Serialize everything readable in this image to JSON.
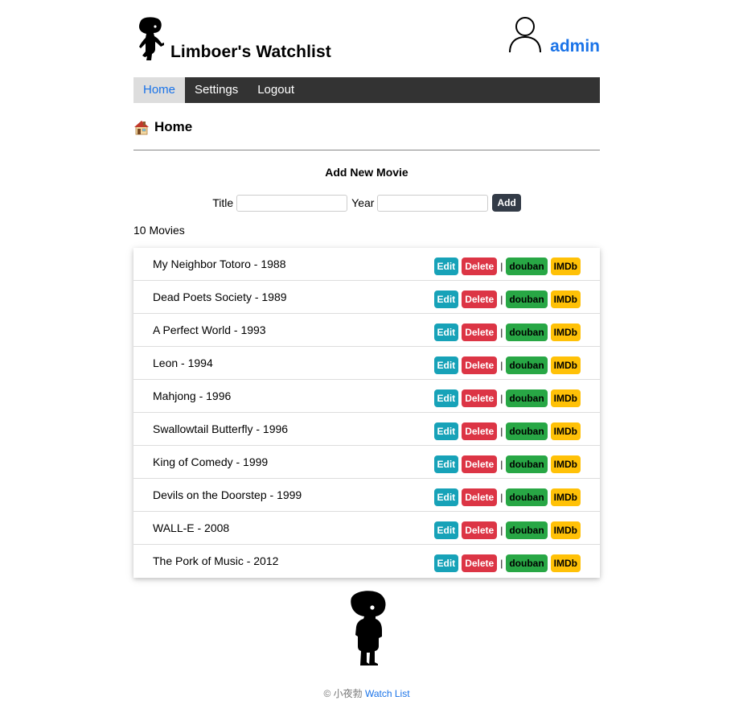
{
  "header": {
    "site_title": "Limboer's Watchlist",
    "username": "admin"
  },
  "nav": {
    "items": [
      {
        "label": "Home",
        "active": true
      },
      {
        "label": "Settings",
        "active": false
      },
      {
        "label": "Logout",
        "active": false
      }
    ]
  },
  "page": {
    "heading": "Home",
    "heading_icon": "house-icon"
  },
  "form": {
    "title": "Add New Movie",
    "title_label": "Title",
    "title_value": "",
    "year_label": "Year",
    "year_value": "",
    "submit_label": "Add"
  },
  "movie_count": "10 Movies",
  "movies": [
    {
      "name": "My Neighbor Totoro - 1988"
    },
    {
      "name": "Dead Poets Society - 1989"
    },
    {
      "name": "A Perfect World - 1993"
    },
    {
      "name": "Leon - 1994"
    },
    {
      "name": "Mahjong - 1996"
    },
    {
      "name": "Swallowtail Butterfly - 1996"
    },
    {
      "name": "King of Comedy - 1999"
    },
    {
      "name": "Devils on the Doorstep - 1999"
    },
    {
      "name": "WALL-E - 2008"
    },
    {
      "name": "The Pork of Music - 2012"
    }
  ],
  "row_actions": {
    "edit": "Edit",
    "delete": "Delete",
    "separator": "|",
    "douban": "douban",
    "imdb": "IMDb"
  },
  "footer": {
    "copyright": "© 小夜勃",
    "link_text": "Watch List"
  },
  "colors": {
    "nav_bg": "#333333",
    "link_blue": "#1a73e8",
    "edit": "#17a2b8",
    "delete": "#dc3545",
    "douban": "#28a745",
    "imdb": "#ffc107"
  }
}
